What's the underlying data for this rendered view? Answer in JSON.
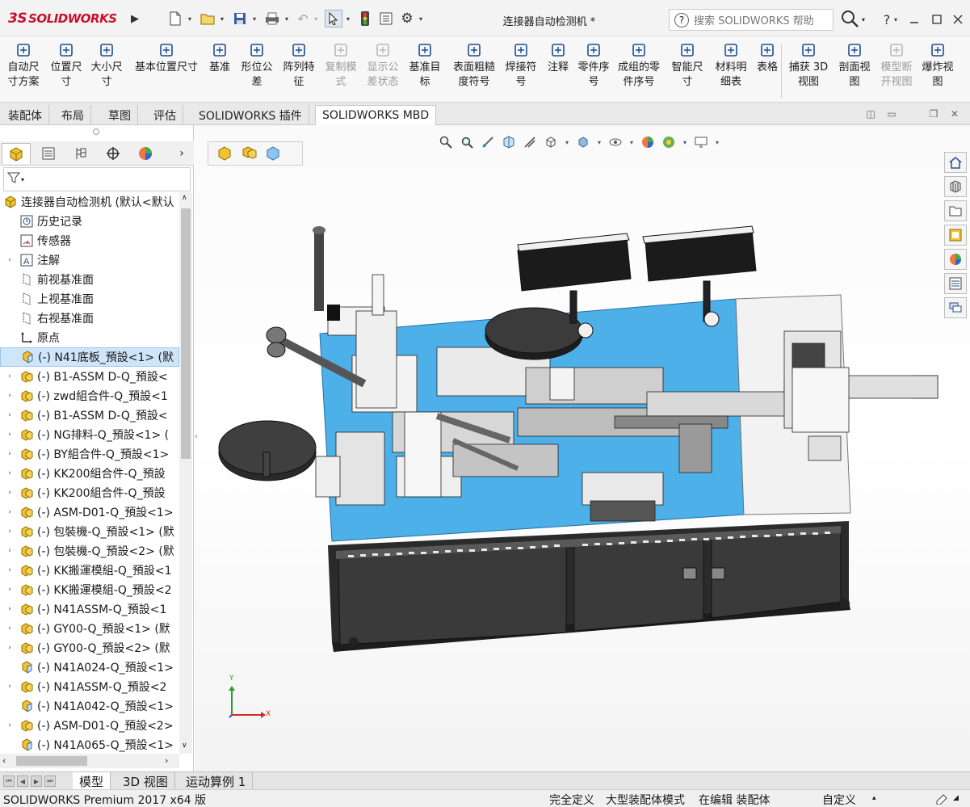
{
  "app": {
    "logo_ds": "3S",
    "logo_text_solid": "SOLID",
    "logo_text_works": "WORKS",
    "document_title": "连接器自动检测机 *",
    "help_search_placeholder": "搜索 SOLIDWORKS 帮助",
    "help_mark": "?"
  },
  "toolbar": {
    "tools": [
      {
        "label": "自动尺\n寸方案",
        "icon": "auto-dimension-icon",
        "disabled": false
      },
      {
        "label": "位置尺\n寸",
        "icon": "location-dimension-icon",
        "disabled": false
      },
      {
        "label": "大小尺\n寸",
        "icon": "size-dimension-icon",
        "disabled": false
      },
      {
        "label": "基本位置尺寸",
        "icon": "basic-location-dimension-icon",
        "disabled": false
      },
      {
        "label": "基准",
        "icon": "datum-icon",
        "disabled": false
      },
      {
        "label": "形位公\n差",
        "icon": "geometric-tolerance-icon",
        "disabled": false
      },
      {
        "label": "阵列特\n征",
        "icon": "pattern-feature-icon",
        "disabled": false
      },
      {
        "label": "复制模\n式",
        "icon": "copy-scheme-icon",
        "disabled": true
      },
      {
        "label": "显示公\n差状态",
        "icon": "tolerance-status-icon",
        "disabled": true
      },
      {
        "label": "基准目\n标",
        "icon": "datum-target-icon",
        "disabled": false
      },
      {
        "label": "表面粗糙\n度符号",
        "icon": "surface-finish-icon",
        "disabled": false
      },
      {
        "label": "焊接符\n号",
        "icon": "weld-symbol-icon",
        "disabled": false
      },
      {
        "label": "注释",
        "icon": "note-icon",
        "disabled": false
      },
      {
        "label": "零件序\n号",
        "icon": "balloon-icon",
        "disabled": false
      },
      {
        "label": "成组的零\n件序号",
        "icon": "stacked-balloon-icon",
        "disabled": false
      },
      {
        "label": "智能尺\n寸",
        "icon": "smart-dimension-icon",
        "disabled": false
      },
      {
        "label": "材料明\n细表",
        "icon": "bom-icon",
        "disabled": false
      },
      {
        "label": "表格",
        "icon": "table-icon",
        "disabled": false
      },
      {
        "label": "捕获 3D\n视图",
        "icon": "capture-3d-view-icon",
        "disabled": false
      },
      {
        "label": "剖面视\n图",
        "icon": "section-view-icon",
        "disabled": false
      },
      {
        "label": "模型断\n开视图",
        "icon": "model-break-view-icon",
        "disabled": true
      },
      {
        "label": "爆炸视\n图",
        "icon": "explode-view-icon",
        "disabled": false
      }
    ]
  },
  "tabs": [
    "装配体",
    "布局",
    "草图",
    "评估",
    "SOLIDWORKS 插件",
    "SOLIDWORKS MBD"
  ],
  "active_tab": "SOLIDWORKS MBD",
  "tree": {
    "root": "连接器自动检测机 (默认<默认",
    "items": [
      {
        "label": "历史记录",
        "icon": "history-icon",
        "expand": false
      },
      {
        "label": "传感器",
        "icon": "sensor-icon",
        "expand": false
      },
      {
        "label": "注解",
        "icon": "annotation-icon",
        "expand": true
      },
      {
        "label": "前视基准面",
        "icon": "plane-icon",
        "expand": false
      },
      {
        "label": "上视基准面",
        "icon": "plane-icon",
        "expand": false
      },
      {
        "label": "右视基准面",
        "icon": "plane-icon",
        "expand": false
      },
      {
        "label": "原点",
        "icon": "origin-icon",
        "expand": false
      },
      {
        "label": "(-) N41底板_預設<1> (默",
        "icon": "part-icon",
        "expand": false,
        "selected": true
      },
      {
        "label": "(-) B1-ASSM D-Q_預設<",
        "icon": "subassembly-icon",
        "expand": true
      },
      {
        "label": "(-) zwd組合件-Q_預設<1",
        "icon": "subassembly-icon",
        "expand": true
      },
      {
        "label": "(-) B1-ASSM D-Q_預設<",
        "icon": "subassembly-icon",
        "expand": true
      },
      {
        "label": "(-) NG排料-Q_預設<1> (",
        "icon": "subassembly-icon",
        "expand": true
      },
      {
        "label": "(-) BY組合件-Q_預設<1>",
        "icon": "subassembly-icon",
        "expand": true
      },
      {
        "label": "(-) KK200組合件-Q_預設",
        "icon": "subassembly-icon",
        "expand": true
      },
      {
        "label": "(-) KK200組合件-Q_預設",
        "icon": "subassembly-icon",
        "expand": true
      },
      {
        "label": "(-) ASM-D01-Q_預設<1>",
        "icon": "subassembly-icon",
        "expand": true
      },
      {
        "label": "(-) 包裝機-Q_預設<1> (默",
        "icon": "subassembly-icon",
        "expand": true
      },
      {
        "label": "(-) 包裝機-Q_預設<2> (默",
        "icon": "subassembly-icon",
        "expand": true
      },
      {
        "label": "(-) KK搬運模組-Q_預設<1",
        "icon": "subassembly-icon",
        "expand": true
      },
      {
        "label": "(-) KK搬運模組-Q_預設<2",
        "icon": "subassembly-icon",
        "expand": true
      },
      {
        "label": "(-) N41ASSM-Q_預設<1",
        "icon": "subassembly-icon",
        "expand": true
      },
      {
        "label": "(-) GY00-Q_預設<1> (默",
        "icon": "subassembly-icon",
        "expand": true
      },
      {
        "label": "(-) GY00-Q_預設<2> (默",
        "icon": "subassembly-icon",
        "expand": true
      },
      {
        "label": "(-) N41A024-Q_預設<1>",
        "icon": "part-icon",
        "expand": false
      },
      {
        "label": "(-) N41ASSM-Q_預設<2",
        "icon": "subassembly-icon",
        "expand": true
      },
      {
        "label": "(-) N41A042-Q_預設<1>",
        "icon": "part-icon",
        "expand": false
      },
      {
        "label": "(-) ASM-D01-Q_預設<2>",
        "icon": "subassembly-icon",
        "expand": true
      },
      {
        "label": "(-) N41A065-Q_預設<1>",
        "icon": "part-icon",
        "expand": false
      }
    ]
  },
  "triad": {
    "x": "X",
    "y": "Y"
  },
  "bottom_tabs": [
    "模型",
    "3D 视图",
    "运动算例 1"
  ],
  "active_bottom_tab": "模型",
  "status": {
    "product": "SOLIDWORKS Premium 2017 x64 版",
    "definition": "完全定义",
    "mode": "大型装配体模式",
    "editing": "在编辑 装配体",
    "units": "自定义"
  },
  "colors": {
    "accent": "#c8102e",
    "base_plate": "#4eb0e8",
    "frame": "#2e2e2e",
    "selection": "#cfe5fa"
  }
}
